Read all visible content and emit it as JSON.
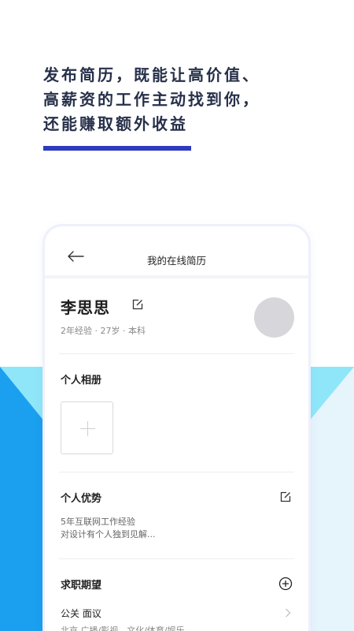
{
  "promo": {
    "headline_lines": [
      "发布简历，既能让高价值、",
      "高薪资的工作主动找到你，",
      "还能赚取额外收益"
    ],
    "accent_color": "#2f3bbf"
  },
  "colors": {
    "bg_cyan": "#8fe6f9",
    "bg_blue": "#1aa0ef",
    "bg_light": "#e6f4fc"
  },
  "nav": {
    "title": "我的在线简历",
    "back_icon": "arrow-left-icon"
  },
  "profile": {
    "name": "李思思",
    "meta": "2年经验 · 27岁 · 本科",
    "edit_icon": "edit-icon"
  },
  "album": {
    "heading": "个人相册",
    "add_icon": "plus-icon"
  },
  "advantage": {
    "heading": "个人优势",
    "lines": [
      "5年互联网工作经验",
      "对设计有个人独到见解..."
    ]
  },
  "expectation": {
    "heading": "求职期望",
    "job_title": "公关  面议",
    "job_detail": "北京  广播/影视、文化/体育/娱乐"
  }
}
